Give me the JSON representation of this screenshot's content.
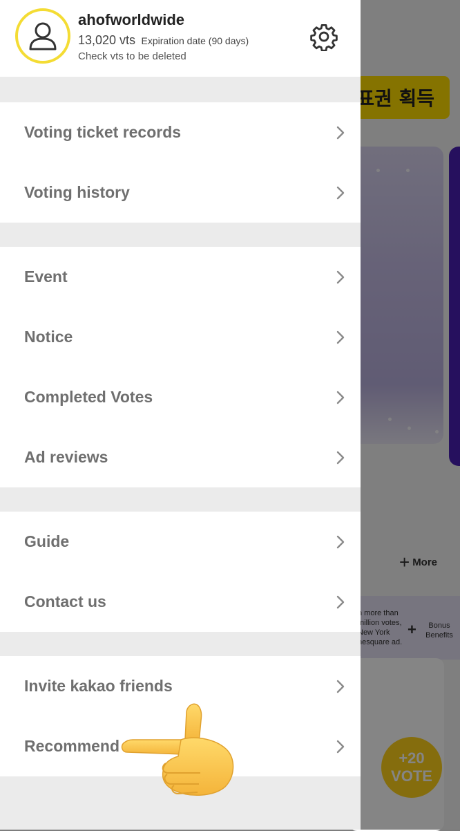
{
  "background": {
    "banner_text": "표권 획득",
    "more_label": "More",
    "promo_text": "n more than million votes, New York nesquare ad.",
    "bonus_text": "Bonus Benefits",
    "vote_badge_top": "+20",
    "vote_badge_bottom": "VOTE"
  },
  "profile": {
    "username": "ahofworldwide",
    "vts": "13,020 vts",
    "expiration": "Expiration date (90 days)",
    "check_vts": "Check vts to be deleted"
  },
  "menu": {
    "group1": [
      {
        "label": "Voting ticket records"
      },
      {
        "label": "Voting history"
      }
    ],
    "group2": [
      {
        "label": "Event"
      },
      {
        "label": "Notice"
      },
      {
        "label": "Completed Votes"
      },
      {
        "label": "Ad reviews"
      }
    ],
    "group3": [
      {
        "label": "Guide"
      },
      {
        "label": "Contact us"
      }
    ],
    "group4": [
      {
        "label": "Invite kakao friends"
      },
      {
        "label": "Recommend"
      }
    ]
  },
  "colors": {
    "avatar_ring": "#f4dc34",
    "banner": "#ffdc00",
    "vote_badge": "#ffd21a",
    "menu_text": "#6f6f6f"
  },
  "icons": {
    "avatar": "user-outline-icon",
    "settings": "gear-icon",
    "chevron": "chevron-right-icon",
    "hand": "pointing-hand-icon"
  }
}
